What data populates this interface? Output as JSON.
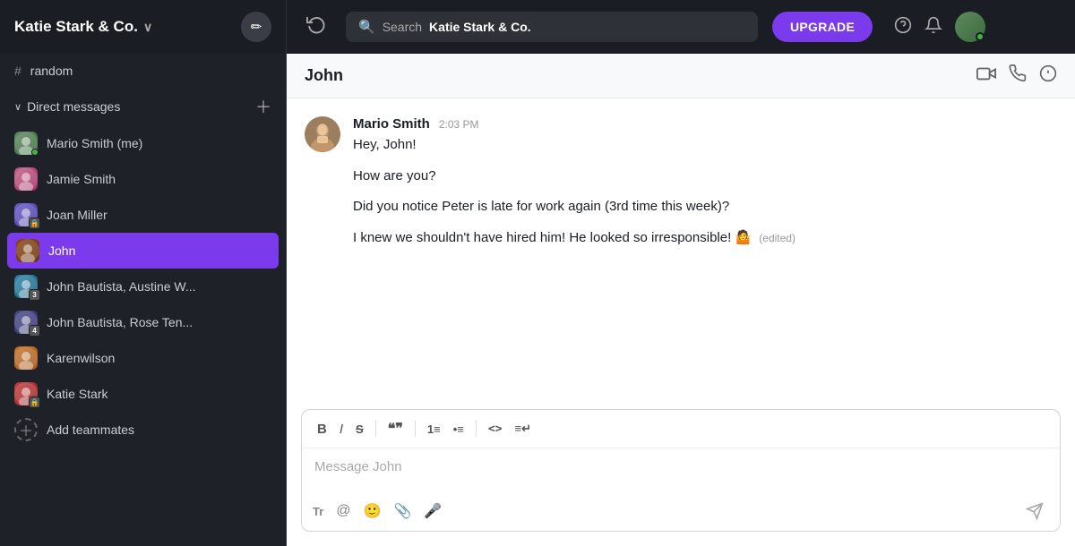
{
  "workspace": {
    "name": "Katie Stark & Co.",
    "edit_label": "✏"
  },
  "header": {
    "search_placeholder": "Search",
    "search_workspace": "Katie Stark & Co.",
    "upgrade_label": "UPGRADE",
    "history_icon": "↺"
  },
  "sidebar": {
    "channel_label": "random",
    "dm_section_label": "Direct messages",
    "dm_items": [
      {
        "name": "Mario Smith (me)",
        "avatar_class": "av-mario",
        "badge": null,
        "status": "green"
      },
      {
        "name": "Jamie Smith",
        "avatar_class": "av-jamie",
        "badge": null,
        "status": null
      },
      {
        "name": "Joan Miller",
        "avatar_class": "av-joan",
        "badge": "🔒",
        "status": null
      },
      {
        "name": "John",
        "avatar_class": "av-john",
        "badge": null,
        "status": null,
        "active": true
      },
      {
        "name": "John Bautista, Austine W...",
        "avatar_class": "av-johnb1",
        "badge": "3",
        "status": null
      },
      {
        "name": "John Bautista, Rose Ten...",
        "avatar_class": "av-johnb2",
        "badge": "4",
        "status": null
      },
      {
        "name": "Karenwilson",
        "avatar_class": "av-karen",
        "badge": null,
        "status": null
      },
      {
        "name": "Katie Stark",
        "avatar_class": "av-katie",
        "badge": "🔒",
        "status": null
      }
    ],
    "add_teammates_label": "Add teammates"
  },
  "chat": {
    "title": "John",
    "message": {
      "sender": "Mario Smith",
      "time": "2:03 PM",
      "lines": [
        "Hey, John!",
        "How are you?",
        "Did you notice Peter is late for work again (3rd time this week)?",
        "I knew we shouldn't have hired him! He looked so irresponsible! 🤷 (edited)"
      ]
    },
    "input_placeholder": "Message John",
    "toolbar": {
      "bold": "B",
      "italic": "I",
      "strikethrough": "S",
      "quote": "❝",
      "ol": "≡",
      "ul": "≡",
      "code": "<>",
      "indent": "≡↵"
    }
  }
}
